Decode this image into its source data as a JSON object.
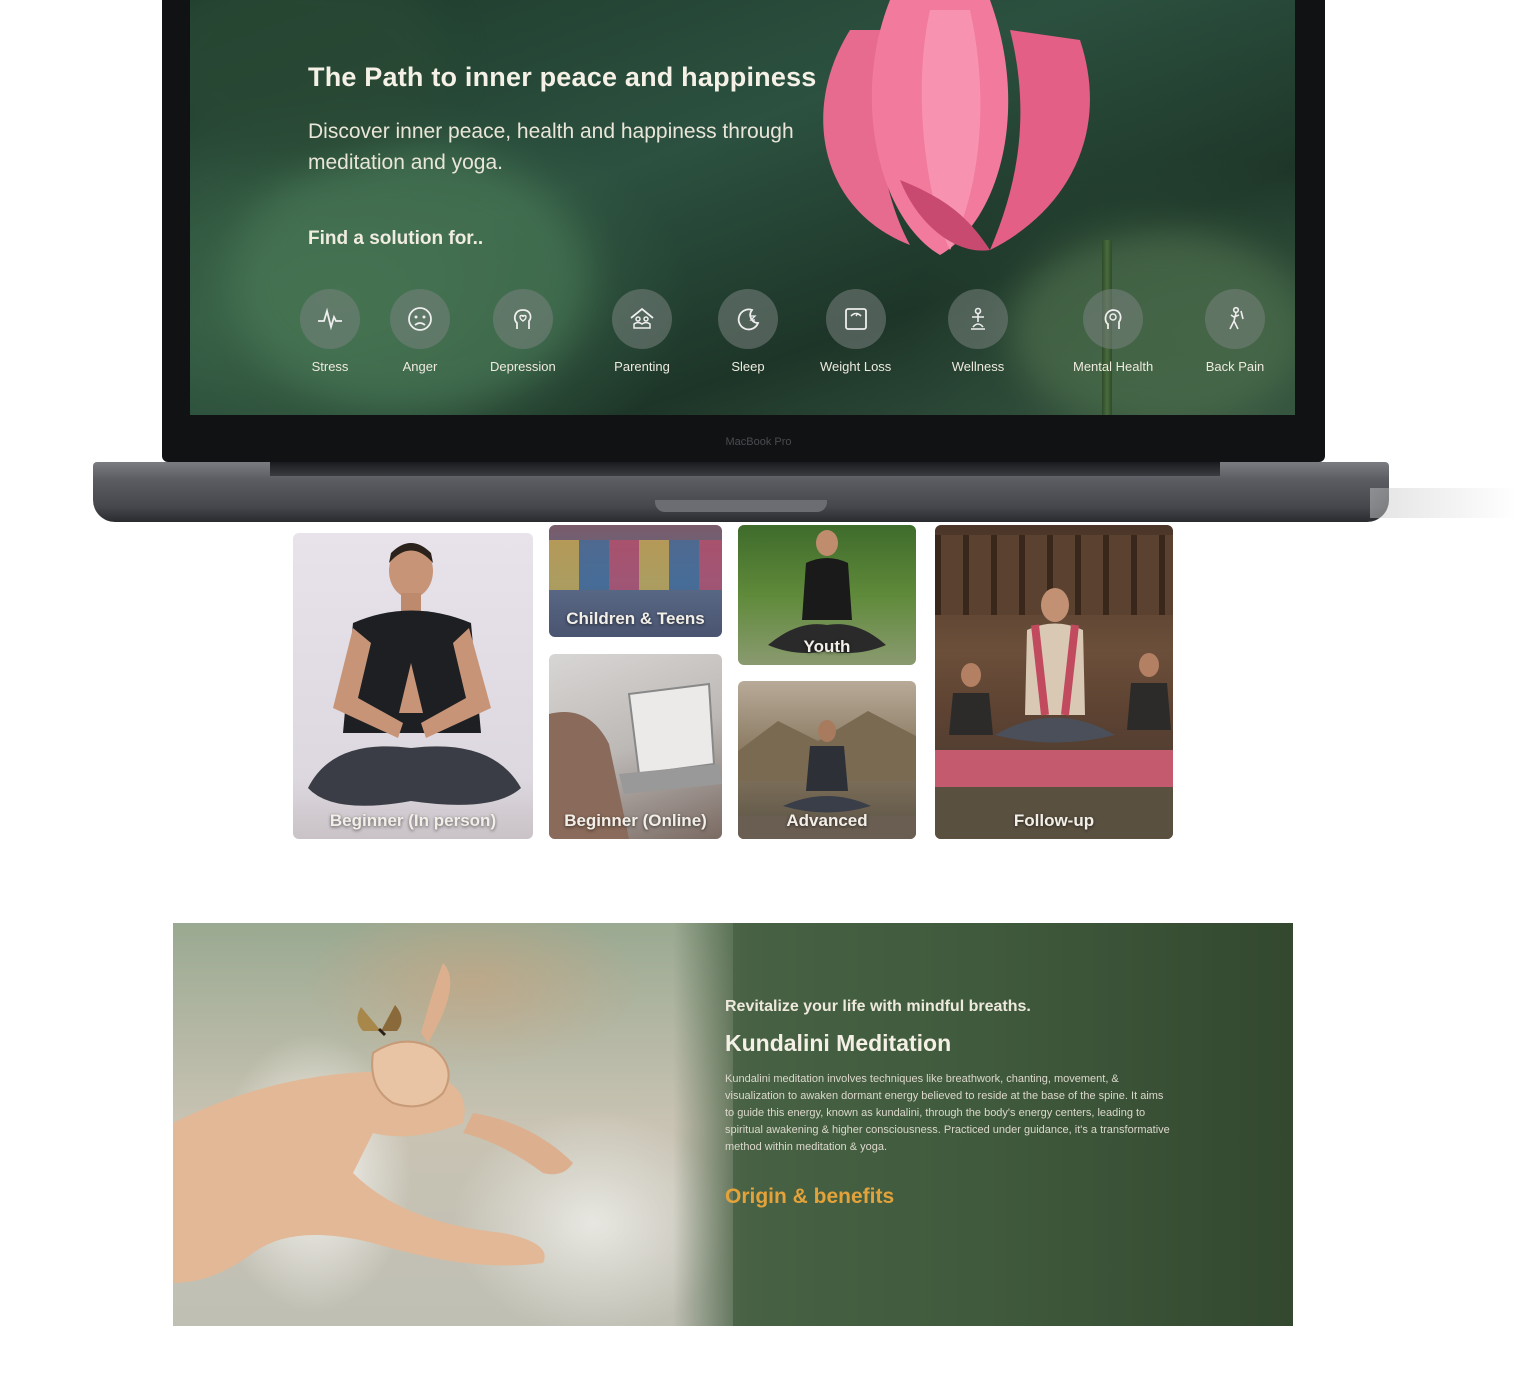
{
  "hero": {
    "title": "The Path to inner peace and happiness",
    "subtitle": "Discover inner peace, health and happiness through meditation and yoga.",
    "find_label": "Find a solution for.."
  },
  "solutions": [
    {
      "label": "Stress",
      "icon": "pulse-icon"
    },
    {
      "label": "Anger",
      "icon": "angry-face-icon"
    },
    {
      "label": "Depression",
      "icon": "head-heart-icon"
    },
    {
      "label": "Parenting",
      "icon": "family-icon"
    },
    {
      "label": "Sleep",
      "icon": "moon-icon"
    },
    {
      "label": "Weight Loss",
      "icon": "scale-icon"
    },
    {
      "label": "Wellness",
      "icon": "wellness-icon"
    },
    {
      "label": "Mental Health",
      "icon": "brain-icon"
    },
    {
      "label": "Back Pain",
      "icon": "back-icon"
    }
  ],
  "laptop": {
    "brand": "MacBook Pro"
  },
  "programs": [
    {
      "label": "Beginner (In person)"
    },
    {
      "label": "Children & Teens"
    },
    {
      "label": "Youth"
    },
    {
      "label": "Beginner (Online)"
    },
    {
      "label": "Advanced"
    },
    {
      "label": "Follow-up"
    }
  ],
  "kundalini": {
    "tagline": "Revitalize your life with mindful breaths.",
    "title": "Kundalini Meditation",
    "body": "Kundalini meditation involves techniques like breathwork, chanting, movement, & visualization to awaken dormant energy believed to reside at the base of the spine. It aims to guide this energy, known as kundalini, through the body's energy centers, leading to spiritual awakening & higher consciousness. Practiced under guidance, it's a transformative method within meditation & yoga.",
    "link": "Origin & benefits",
    "link_color": "#e3a23a"
  }
}
